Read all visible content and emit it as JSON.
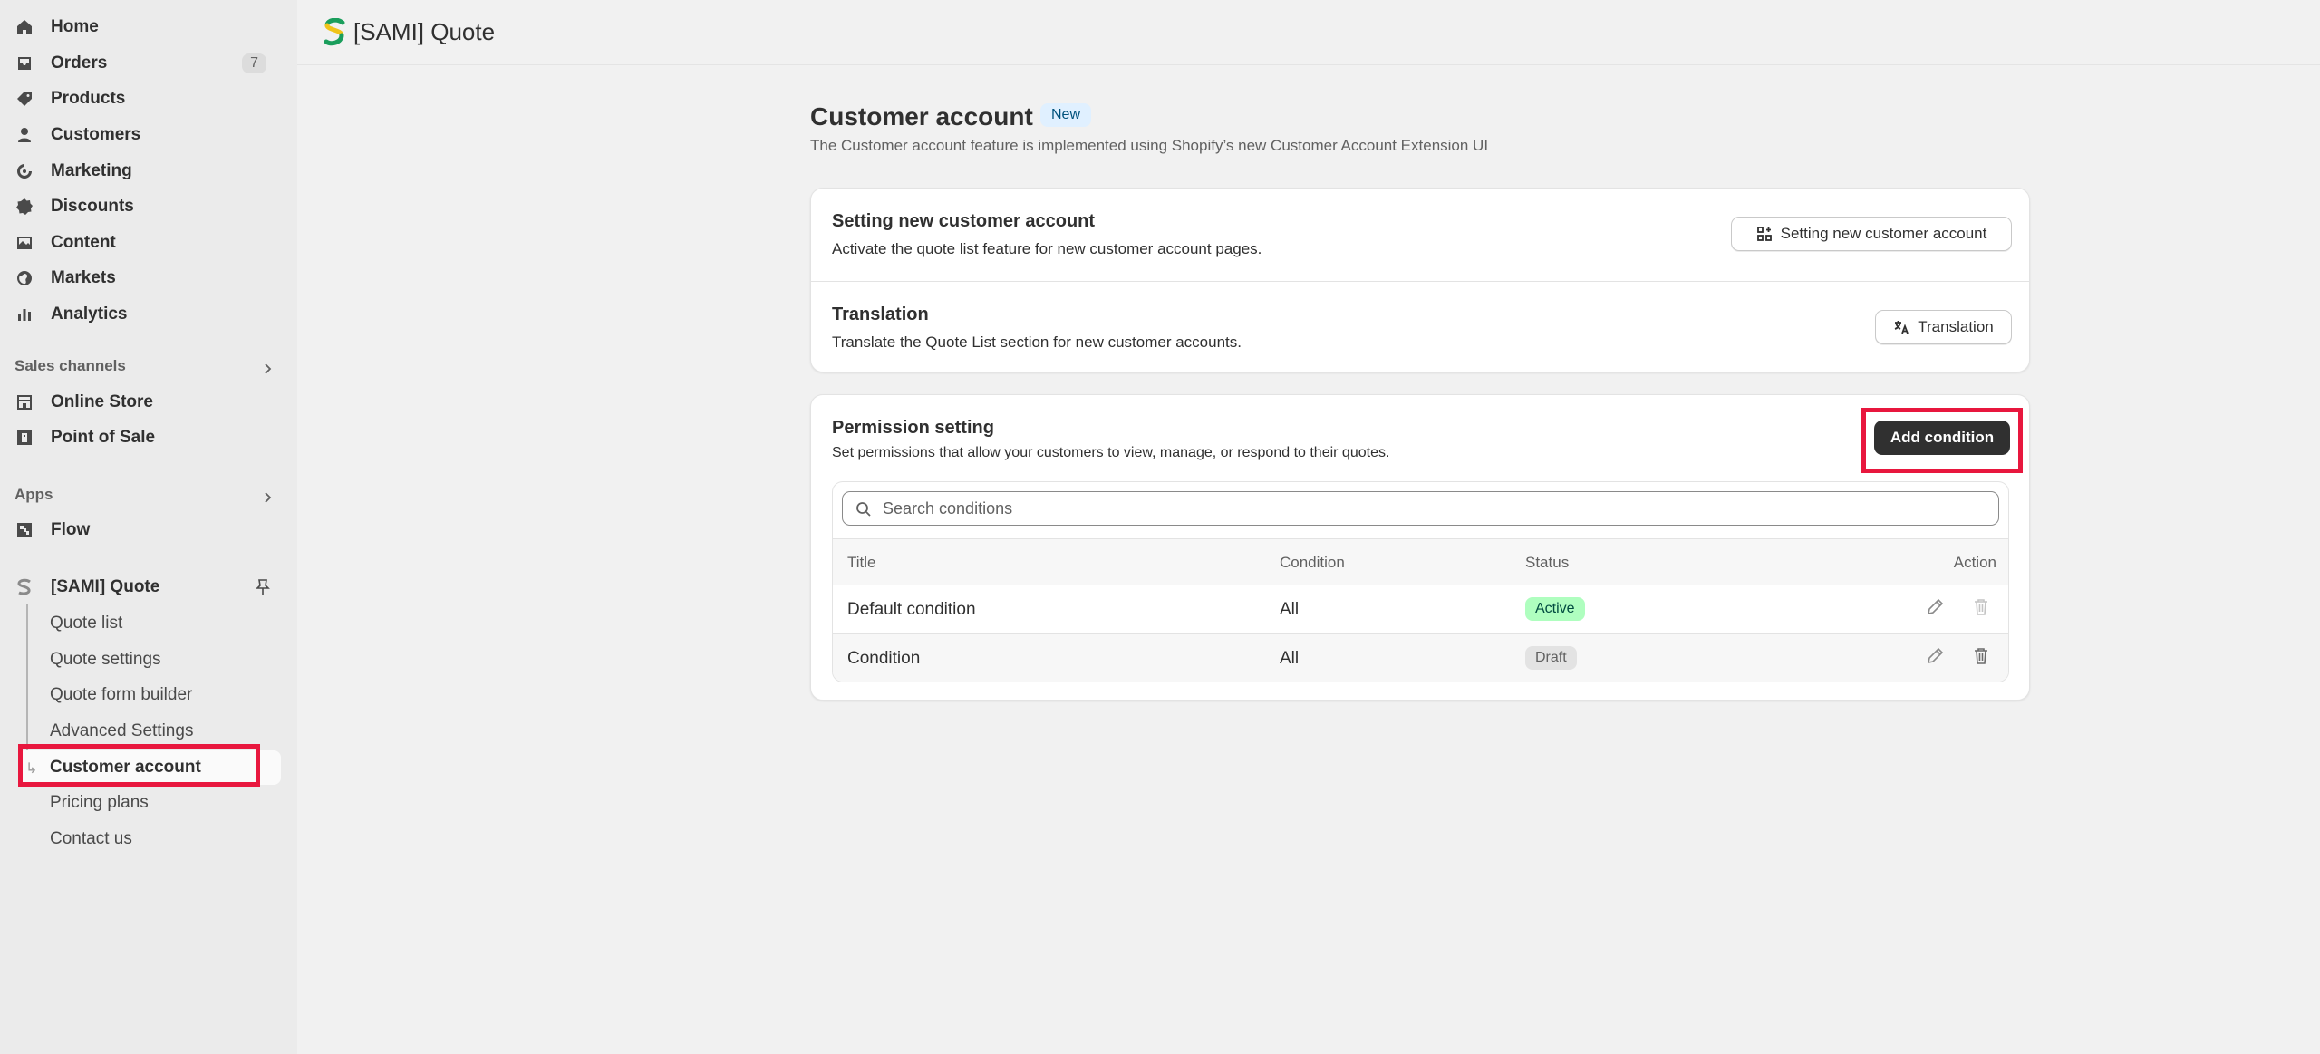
{
  "sidebar": {
    "nav": [
      {
        "label": "Home",
        "icon": "home-icon"
      },
      {
        "label": "Orders",
        "icon": "inbox-icon",
        "badge": "7"
      },
      {
        "label": "Products",
        "icon": "tag-icon"
      },
      {
        "label": "Customers",
        "icon": "person-icon"
      },
      {
        "label": "Marketing",
        "icon": "target-icon"
      },
      {
        "label": "Discounts",
        "icon": "discount-icon"
      },
      {
        "label": "Content",
        "icon": "image-icon"
      },
      {
        "label": "Markets",
        "icon": "globe-icon"
      },
      {
        "label": "Analytics",
        "icon": "bar-chart-icon"
      }
    ],
    "sales_channels": {
      "title": "Sales channels",
      "items": [
        {
          "label": "Online Store",
          "icon": "store-icon"
        },
        {
          "label": "Point of Sale",
          "icon": "pos-icon"
        }
      ]
    },
    "apps": {
      "title": "Apps",
      "items": [
        {
          "label": "Flow",
          "icon": "flow-icon"
        }
      ]
    },
    "app": {
      "label": "[SAMI] Quote",
      "sub_items": [
        "Quote list",
        "Quote settings",
        "Quote form builder",
        "Advanced Settings",
        "Customer account",
        "Pricing plans",
        "Contact us"
      ]
    }
  },
  "topbar": {
    "title": "[SAMI] Quote"
  },
  "page": {
    "title": "Customer account",
    "badge": "New",
    "subtitle": "The Customer account feature is implemented using Shopify’s new Customer Account Extension UI"
  },
  "settings_card": {
    "setting": {
      "title": "Setting new customer account",
      "description": "Activate the quote list feature for new customer account pages.",
      "button": "Setting new customer account"
    },
    "translation": {
      "title": "Translation",
      "description": "Translate the Quote List section for new customer accounts.",
      "button": "Translation"
    }
  },
  "permission_card": {
    "title": "Permission setting",
    "description": "Set permissions that allow your customers to view, manage, or respond to their quotes.",
    "button": "Add condition",
    "search_placeholder": "Search conditions",
    "columns": [
      "Title",
      "Condition",
      "Status",
      "Action"
    ],
    "rows": [
      {
        "title": "Default condition",
        "condition": "All",
        "status": "Active"
      },
      {
        "title": "Condition",
        "condition": "All",
        "status": "Draft"
      }
    ]
  },
  "colors": {
    "highlight": "#e8173e",
    "active_badge": "#affebf",
    "draft_badge": "#e3e3e3",
    "primary_button": "#303030"
  }
}
